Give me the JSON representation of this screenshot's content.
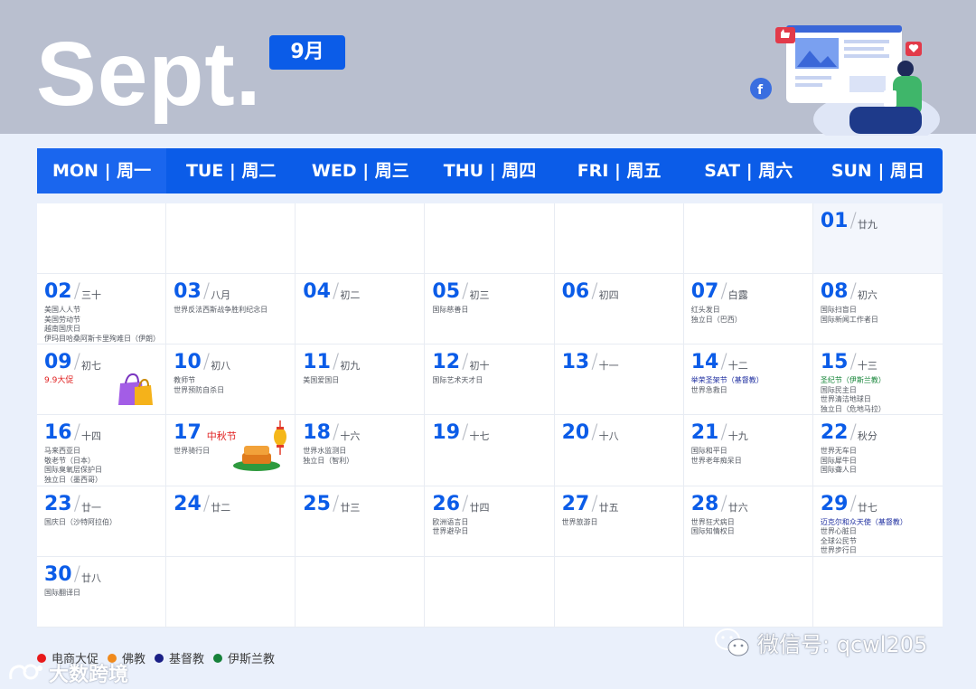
{
  "header": {
    "title": "Sept.",
    "month_badge": "9月"
  },
  "weekdays": [
    "MON | 周一",
    "TUE | 周二",
    "WED | 周三",
    "THU | 周四",
    "FRI | 周五",
    "SAT | 周六",
    "SUN | 周日"
  ],
  "days": {
    "d01": {
      "num": "01",
      "lunar": "廿九"
    },
    "d02": {
      "num": "02",
      "lunar": "三十",
      "events": [
        "美国人人节",
        "美国劳动节",
        "越南国庆日",
        "伊玛目哈桑阿斯卡里殉难日（伊朗）"
      ]
    },
    "d03": {
      "num": "03",
      "lunar": "八月",
      "events": [
        "世界反法西斯战争胜利纪念日"
      ]
    },
    "d04": {
      "num": "04",
      "lunar": "初二"
    },
    "d05": {
      "num": "05",
      "lunar": "初三",
      "events": [
        "国际慈善日"
      ]
    },
    "d06": {
      "num": "06",
      "lunar": "初四"
    },
    "d07": {
      "num": "07",
      "lunar": "白露",
      "events": [
        "红头发日",
        "独立日（巴西）"
      ]
    },
    "d08": {
      "num": "08",
      "lunar": "初六",
      "events": [
        "国际扫盲日",
        "国际新闻工作者日"
      ]
    },
    "d09": {
      "num": "09",
      "lunar": "初七",
      "events": [
        "9.9大促"
      ]
    },
    "d10": {
      "num": "10",
      "lunar": "初八",
      "events": [
        "教师节",
        "世界预防自杀日"
      ]
    },
    "d11": {
      "num": "11",
      "lunar": "初九",
      "events": [
        "美国爱国日"
      ]
    },
    "d12": {
      "num": "12",
      "lunar": "初十",
      "events": [
        "国际艺术天才日"
      ]
    },
    "d13": {
      "num": "13",
      "lunar": "十一"
    },
    "d14": {
      "num": "14",
      "lunar": "十二",
      "events": [
        "举荣圣架节（基督教）",
        "世界急救日"
      ]
    },
    "d15": {
      "num": "15",
      "lunar": "十三",
      "events": [
        "圣纪节（伊斯兰教）",
        "国际民主日",
        "世界清洁地球日",
        "独立日（危地马拉）"
      ]
    },
    "d16": {
      "num": "16",
      "lunar": "十四",
      "events": [
        "马来西亚日",
        "敬老节（日本）",
        "国际臭氧层保护日",
        "独立日（墨西哥）"
      ]
    },
    "d17": {
      "num": "17",
      "lunar": "中秋节",
      "promo": "中秋节",
      "events": [
        "世界骑行日"
      ]
    },
    "d18": {
      "num": "18",
      "lunar": "十六",
      "events": [
        "世界水监测日",
        "独立日（智利）"
      ]
    },
    "d19": {
      "num": "19",
      "lunar": "十七"
    },
    "d20": {
      "num": "20",
      "lunar": "十八"
    },
    "d21": {
      "num": "21",
      "lunar": "十九",
      "events": [
        "国际和平日",
        "世界老年痴呆日"
      ]
    },
    "d22": {
      "num": "22",
      "lunar": "秋分",
      "events": [
        "世界无车日",
        "国际犀牛日",
        "国际聋人日"
      ]
    },
    "d23": {
      "num": "23",
      "lunar": "廿一",
      "events": [
        "国庆日（沙特阿拉伯）"
      ]
    },
    "d24": {
      "num": "24",
      "lunar": "廿二"
    },
    "d25": {
      "num": "25",
      "lunar": "廿三"
    },
    "d26": {
      "num": "26",
      "lunar": "廿四",
      "events": [
        "欧洲语言日",
        "世界避孕日"
      ]
    },
    "d27": {
      "num": "27",
      "lunar": "廿五",
      "events": [
        "世界旅游日"
      ]
    },
    "d28": {
      "num": "28",
      "lunar": "廿六",
      "events": [
        "世界狂犬病日",
        "国际知情权日"
      ]
    },
    "d29": {
      "num": "29",
      "lunar": "廿七",
      "events": [
        "迈克尔和众天使（基督教）",
        "世界心脏日",
        "全球公民节",
        "世界步行日"
      ]
    },
    "d30": {
      "num": "30",
      "lunar": "廿八",
      "events": [
        "国际翻译日"
      ]
    }
  },
  "legend": [
    {
      "label": "电商大促",
      "color": "#e8191b"
    },
    {
      "label": "佛教",
      "color": "#f08a1c"
    },
    {
      "label": "基督教",
      "color": "#1a1f86"
    },
    {
      "label": "伊斯兰教",
      "color": "#16813a"
    }
  ],
  "watermarks": {
    "left": "大数跨境",
    "right": "微信号: qcwl205"
  },
  "colors": {
    "accent": "#0b5ce8",
    "header_band": "#b9bfcf",
    "background": "#eaf0fb"
  }
}
